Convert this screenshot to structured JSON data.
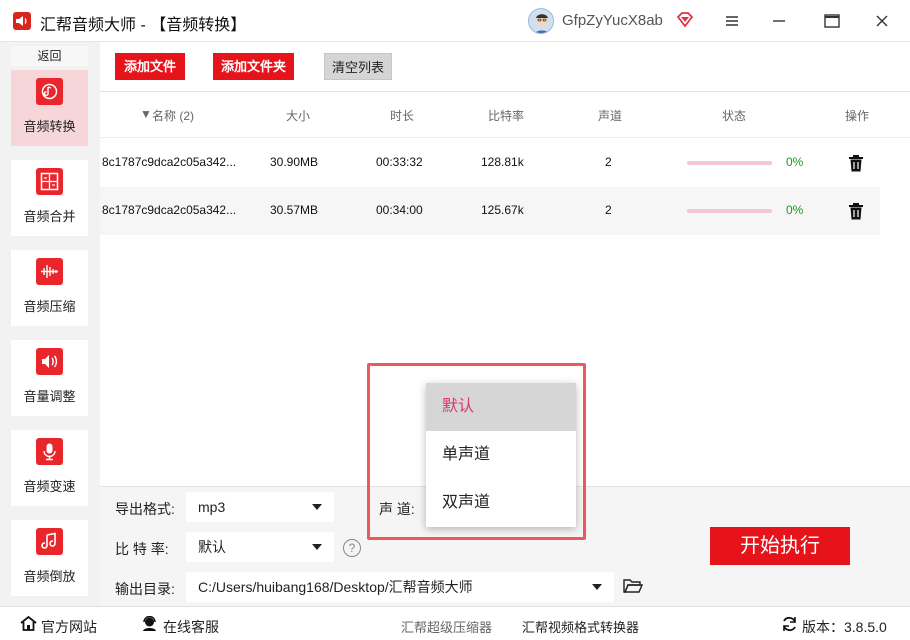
{
  "app": {
    "name": "汇帮音频大师",
    "title_suffix": " - 【音频转换】",
    "username": "GfpZyYucX8ab"
  },
  "sidebar": {
    "back_label": "返回",
    "items": [
      {
        "label": "音频转换",
        "icon": "audio-convert-icon",
        "active": true
      },
      {
        "label": "音频合并",
        "icon": "audio-merge-icon",
        "active": false
      },
      {
        "label": "音频压缩",
        "icon": "audio-compress-icon",
        "active": false
      },
      {
        "label": "音量调整",
        "icon": "volume-icon",
        "active": false
      },
      {
        "label": "音频变速",
        "icon": "speed-mic-icon",
        "active": false
      },
      {
        "label": "音频倒放",
        "icon": "reverse-music-icon",
        "active": false
      }
    ]
  },
  "toolbar": {
    "add_file": "添加文件",
    "add_folder": "添加文件夹",
    "clear_list": "清空列表"
  },
  "table": {
    "headers": {
      "name": "名称 (2)",
      "size": "大小",
      "duration": "时长",
      "bitrate": "比特率",
      "channels": "声道",
      "status": "状态",
      "action": "操作"
    },
    "rows": [
      {
        "name": "8c1787c9dca2c05a342...",
        "size": "30.90MB",
        "duration": "00:33:32",
        "bitrate": "128.81k",
        "channels": "2",
        "progress": "0%"
      },
      {
        "name": "8c1787c9dca2c05a342...",
        "size": "30.57MB",
        "duration": "00:34:00",
        "bitrate": "125.67k",
        "channels": "2",
        "progress": "0%"
      }
    ]
  },
  "settings": {
    "format_label": "导出格式:",
    "format_value": "mp3",
    "bitrate_label": "比 特 率:",
    "bitrate_value": "默认",
    "channel_label": "声 道:",
    "output_label": "输出目录:",
    "output_value": "C:/Users/huibang168/Desktop/汇帮音频大师",
    "help_glyph": "?",
    "start_label": "开始执行"
  },
  "channel_dropdown": {
    "options": [
      "默认",
      "单声道",
      "双声道"
    ],
    "selected": "默认"
  },
  "footer": {
    "website": "官方网站",
    "support": "在线客服",
    "link1": "汇帮超级压缩器",
    "link2": "汇帮视频格式转换器",
    "version": "版本：3.8.5.0"
  },
  "colors": {
    "accent_red": "#e6131b",
    "active_nav_bg": "#f7d6da",
    "progress_text": "#1a9b1a",
    "selected_option": "#e0336a"
  }
}
